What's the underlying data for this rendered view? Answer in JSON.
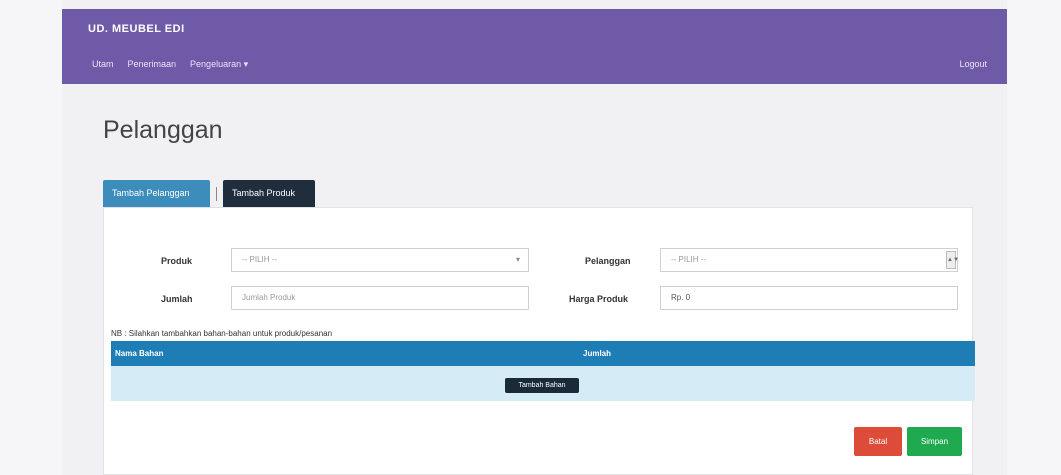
{
  "navbar": {
    "brand": "UD. MEUBEL EDI",
    "links": [
      "Utam",
      "Penerimaan",
      "Pengeluaran ▾"
    ],
    "logout": "Logout"
  },
  "page": {
    "title": "Pelanggan"
  },
  "tabs": [
    {
      "label": "Tambah Pelanggan"
    },
    {
      "label": "Tambah Produk"
    }
  ],
  "form": {
    "produk_label": "Produk",
    "produk_value": "-- PILIH --",
    "pelanggan_label": "Pelanggan",
    "pelanggan_value": "-- PILIH --",
    "jumlah_label": "Jumlah",
    "jumlah_placeholder": "Jumlah Produk",
    "harga_label": "Harga Produk",
    "harga_value": "Rp. 0"
  },
  "note": "NB : Silahkan tambahkan bahan-bahan untuk produk/pesanan",
  "table": {
    "col_name": "Nama Bahan",
    "col_qty": "Jumlah",
    "add_button": "Tambah Bahan"
  },
  "actions": {
    "reset_label": "Batal",
    "save_label": "Simpan"
  },
  "colors": {
    "navbar": "#6f5aa8",
    "tab_active": "#3c8dbc",
    "tab_dark": "#1f2d3d",
    "table_head": "#1e7db4",
    "reset": "#dd4b39",
    "save": "#1faa4f"
  }
}
